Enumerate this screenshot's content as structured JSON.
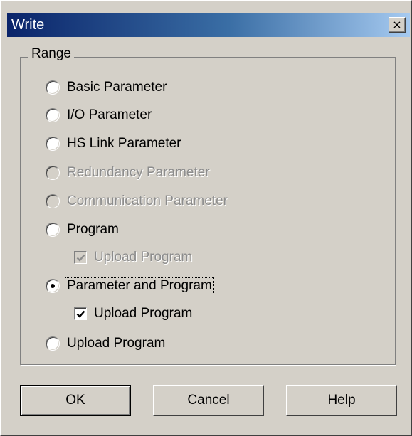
{
  "window": {
    "title": "Write",
    "close_glyph": "×"
  },
  "range": {
    "legend": "Range",
    "options": [
      {
        "label": "Basic Parameter",
        "checked": false,
        "enabled": true
      },
      {
        "label": "I/O Parameter",
        "checked": false,
        "enabled": true
      },
      {
        "label": "HS Link Parameter",
        "checked": false,
        "enabled": true
      },
      {
        "label": "Redundancy Parameter",
        "checked": false,
        "enabled": false
      },
      {
        "label": "Communication Parameter",
        "checked": false,
        "enabled": false
      },
      {
        "label": "Program",
        "checked": false,
        "enabled": true
      },
      {
        "label": "Parameter and Program",
        "checked": true,
        "enabled": true
      },
      {
        "label": "Upload Program",
        "checked": false,
        "enabled": true
      }
    ],
    "program_upload": {
      "label": "Upload Program",
      "checked": true,
      "enabled": false
    },
    "param_program_upload": {
      "label": "Upload Program",
      "checked": true,
      "enabled": true
    }
  },
  "buttons": {
    "ok": "OK",
    "cancel": "Cancel",
    "help": "Help"
  },
  "icons": {
    "close": "close-icon",
    "check": "checkmark-icon"
  },
  "colors": {
    "title_start": "#0a246a",
    "title_end": "#a6caf0",
    "face": "#d4d0c8",
    "disabled_text": "#8c8c8c"
  }
}
